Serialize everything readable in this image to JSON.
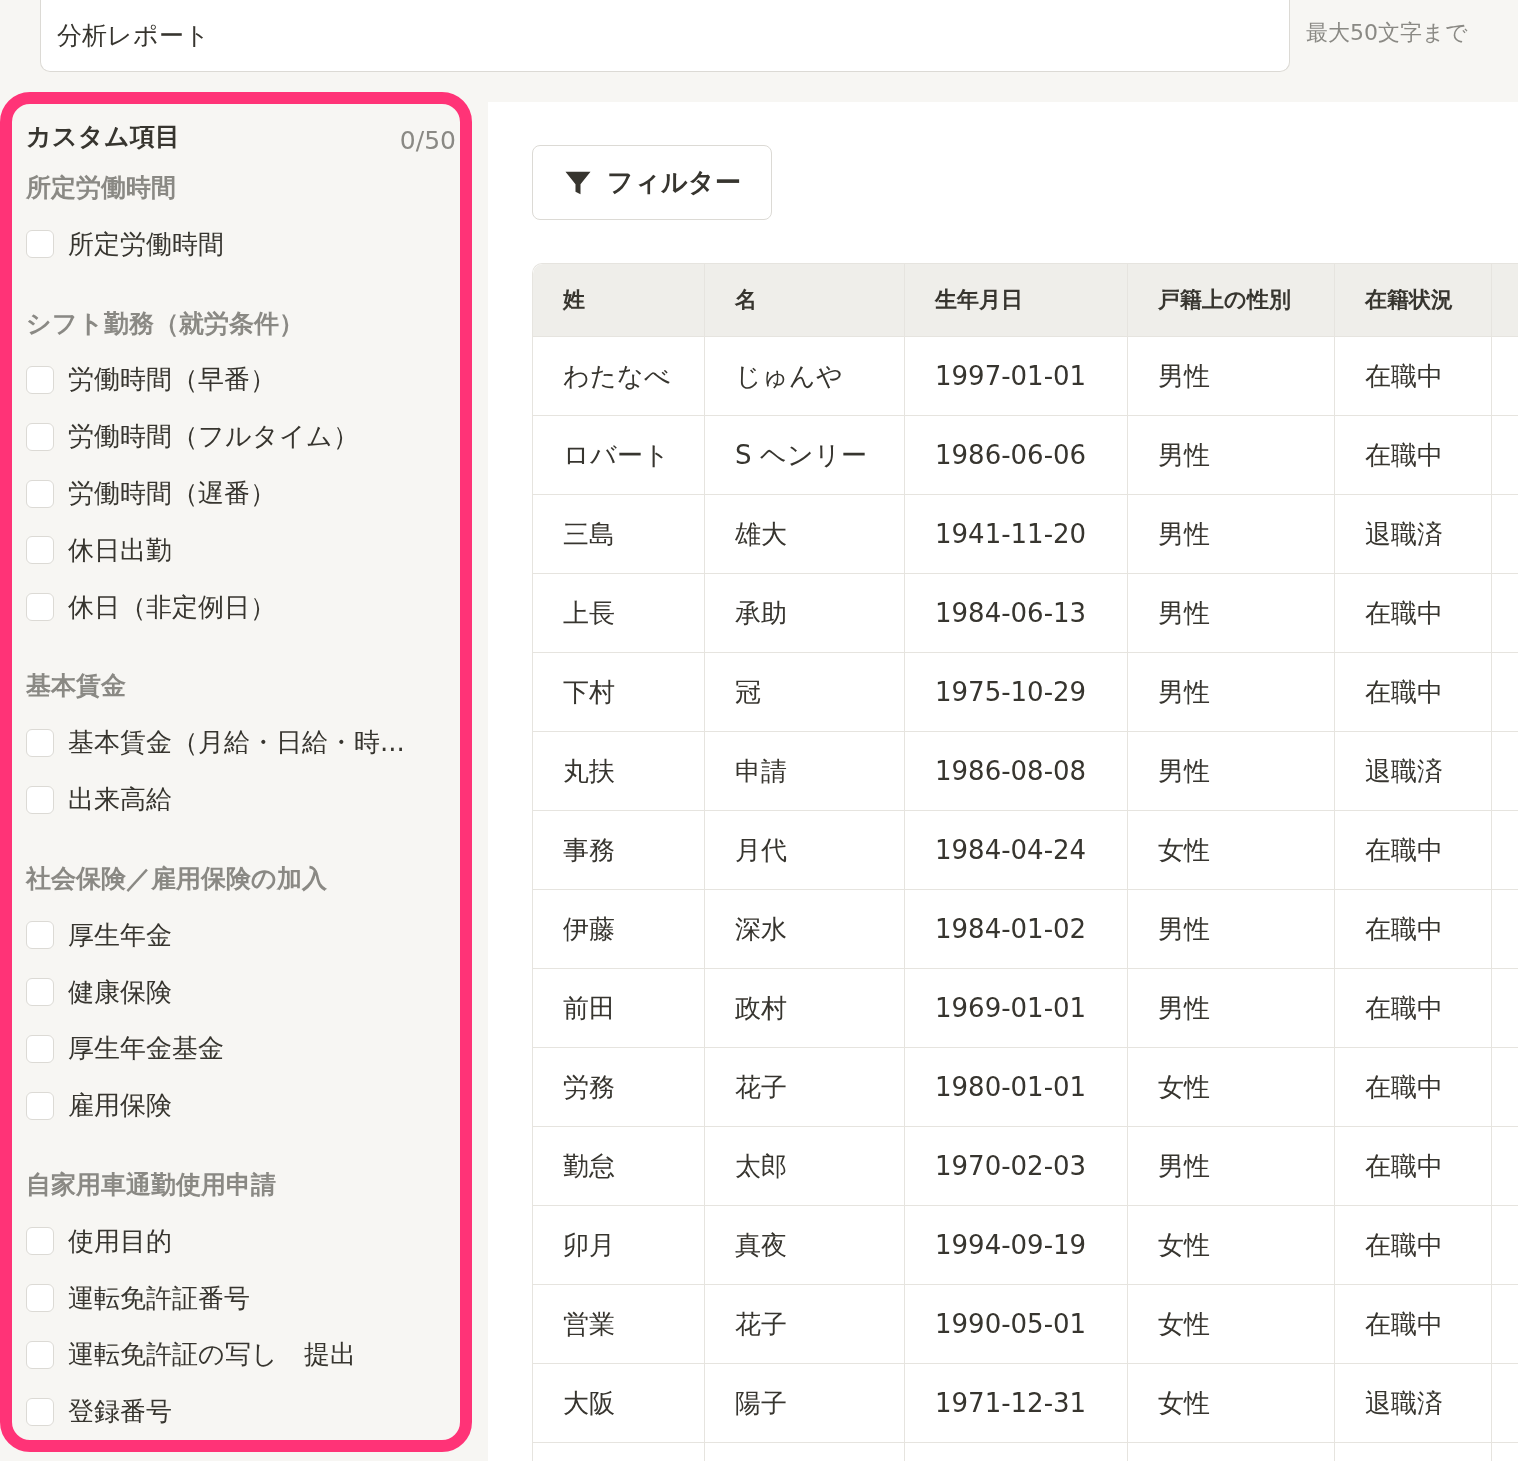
{
  "report_name": {
    "value": "分析レポート",
    "limit_note": "最大50文字まで"
  },
  "custom_items": {
    "title": "カスタム項目",
    "count": "0/50",
    "groups": [
      {
        "heading": "所定労働時間",
        "items": [
          {
            "label": "所定労働時間",
            "checked": false
          }
        ]
      },
      {
        "heading": "シフト勤務（就労条件）",
        "items": [
          {
            "label": "労働時間（早番）",
            "checked": false
          },
          {
            "label": "労働時間（フルタイム）",
            "checked": false
          },
          {
            "label": "労働時間（遅番）",
            "checked": false
          },
          {
            "label": "休日出勤",
            "checked": false
          },
          {
            "label": "休日（非定例日）",
            "checked": false
          }
        ]
      },
      {
        "heading": "基本賃金",
        "items": [
          {
            "label": "基本賃金（月給・日給・時...",
            "checked": false
          },
          {
            "label": "出来高給",
            "checked": false
          }
        ]
      },
      {
        "heading": "社会保険／雇用保険の加入",
        "items": [
          {
            "label": "厚生年金",
            "checked": false
          },
          {
            "label": "健康保険",
            "checked": false
          },
          {
            "label": "厚生年金基金",
            "checked": false
          },
          {
            "label": "雇用保険",
            "checked": false
          }
        ]
      },
      {
        "heading": "自家用車通勤使用申請",
        "items": [
          {
            "label": "使用目的",
            "checked": false
          },
          {
            "label": "運転免許証番号",
            "checked": false
          },
          {
            "label": "運転免許証の写し　提出",
            "checked": false
          },
          {
            "label": "登録番号",
            "checked": false
          }
        ]
      }
    ]
  },
  "filter_button": {
    "label": "フィルター"
  },
  "table": {
    "columns": [
      "姓",
      "名",
      "生年月日",
      "戸籍上の性別",
      "在籍状況"
    ],
    "rows": [
      [
        "わたなべ",
        "じゅんや",
        "1997-01-01",
        "男性",
        "在職中"
      ],
      [
        "ロバート",
        "S ヘンリー",
        "1986-06-06",
        "男性",
        "在職中"
      ],
      [
        "三島",
        "雄大",
        "1941-11-20",
        "男性",
        "退職済"
      ],
      [
        "上長",
        "承助",
        "1984-06-13",
        "男性",
        "在職中"
      ],
      [
        "下村",
        "冠",
        "1975-10-29",
        "男性",
        "在職中"
      ],
      [
        "丸扶",
        "申請",
        "1986-08-08",
        "男性",
        "退職済"
      ],
      [
        "事務",
        "月代",
        "1984-04-24",
        "女性",
        "在職中"
      ],
      [
        "伊藤",
        "深水",
        "1984-01-02",
        "男性",
        "在職中"
      ],
      [
        "前田",
        "政村",
        "1969-01-01",
        "男性",
        "在職中"
      ],
      [
        "労務",
        "花子",
        "1980-01-01",
        "女性",
        "在職中"
      ],
      [
        "勤怠",
        "太郎",
        "1970-02-03",
        "男性",
        "在職中"
      ],
      [
        "卯月",
        "真夜",
        "1994-09-19",
        "女性",
        "在職中"
      ],
      [
        "営業",
        "花子",
        "1990-05-01",
        "女性",
        "在職中"
      ],
      [
        "大阪",
        "陽子",
        "1971-12-31",
        "女性",
        "退職済"
      ]
    ]
  }
}
